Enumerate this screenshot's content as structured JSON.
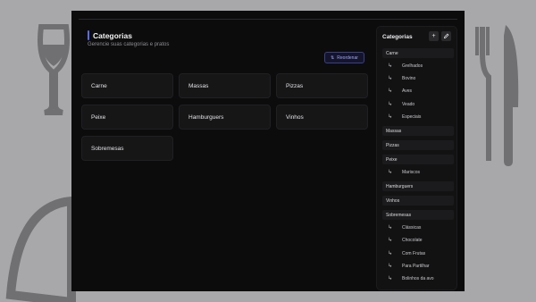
{
  "header": {
    "title": "Categorias",
    "subtitle": "Gerencie suas categorias e pratos"
  },
  "toolbar": {
    "reorder_label": "Reordenar",
    "reorder_icon": "sort-icon"
  },
  "categories": [
    "Carne",
    "Massas",
    "Pizzas",
    "Peixe",
    "Hamburguers",
    "Vinhos",
    "Sobremesas"
  ],
  "panel": {
    "title": "Categorias",
    "add_label": "+",
    "edit_icon": "pencil-icon",
    "tree": [
      {
        "label": "Carne",
        "children": [
          "Grelhados",
          "Bovino",
          "Aves",
          "Veado",
          "Especiais"
        ]
      },
      {
        "label": "Massas",
        "children": []
      },
      {
        "label": "Pizzas",
        "children": []
      },
      {
        "label": "Peixe",
        "children": [
          "Mariscos"
        ]
      },
      {
        "label": "Hamburguers",
        "children": []
      },
      {
        "label": "Vinhos",
        "children": []
      },
      {
        "label": "Sobremesas",
        "children": [
          "Clássicas",
          "Chocolate",
          "Com Frutas",
          "Para Partilhar",
          "Bolinhos da avo"
        ]
      }
    ]
  },
  "colors": {
    "accent": "#5b6cf0",
    "background": "#0c0c0d",
    "card": "#161617"
  }
}
